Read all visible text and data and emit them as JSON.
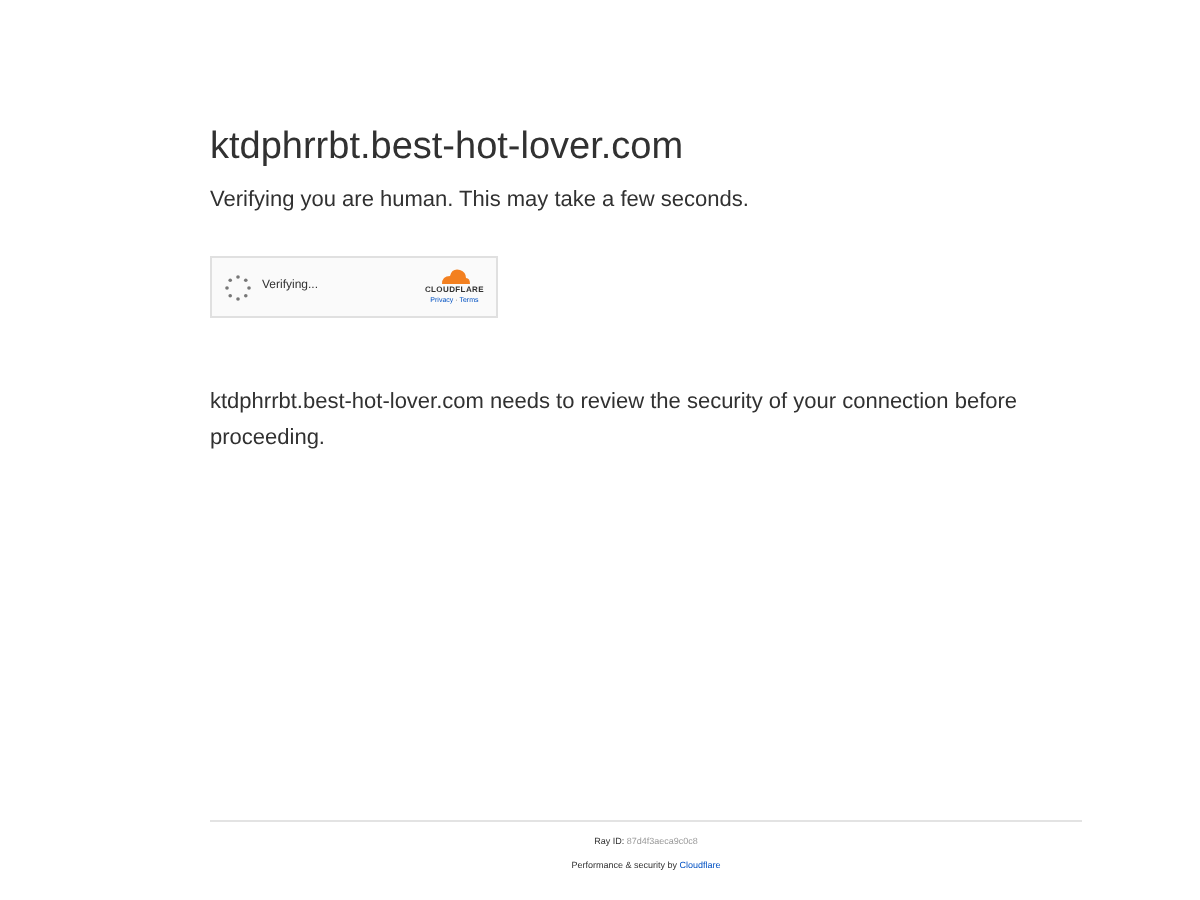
{
  "heading": "ktdphrrbt.best-hot-lover.com",
  "subtitle": "Verifying you are human. This may take a few seconds.",
  "widget": {
    "status": "Verifying...",
    "brand": "CLOUDFLARE",
    "links": [
      "Privacy",
      "Terms"
    ],
    "separator": "·"
  },
  "message": "ktdphrrbt.best-hot-lover.com needs to review the security of your connection before proceeding.",
  "footer": {
    "ray_label": "Ray ID:",
    "ray_id": "87d4f3aeca9c0c8",
    "perf_text": "Performance & security by",
    "perf_link": "Cloudflare"
  }
}
